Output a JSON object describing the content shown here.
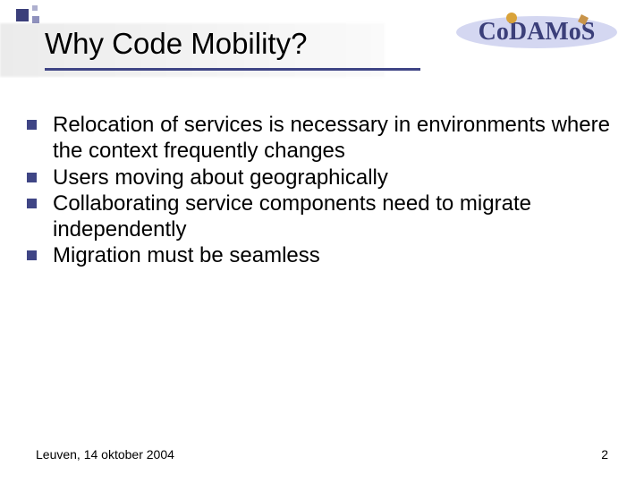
{
  "logo_text": "CoDAMoS",
  "title": "Why Code Mobility?",
  "bullets": [
    "Relocation of services is necessary in environments where the context frequently changes",
    "Users moving about geographically",
    "Collaborating service components need to migrate independently",
    "Migration must be seamless"
  ],
  "footer": {
    "location_date": "Leuven, 14 oktober 2004",
    "page_number": "2"
  }
}
